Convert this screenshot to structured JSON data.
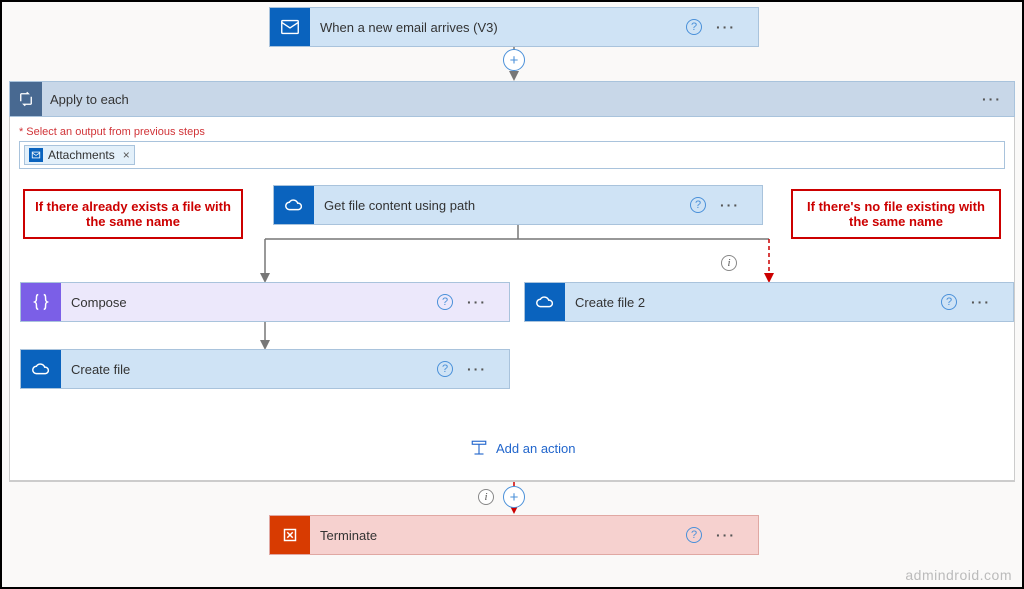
{
  "trigger": {
    "title": "When a new email arrives (V3)"
  },
  "loop": {
    "title": "Apply to each",
    "select_label": "Select an output from previous steps",
    "token_label": "Attachments"
  },
  "actions": {
    "get_file": "Get file content using path",
    "compose": "Compose",
    "create_file_left": "Create file",
    "create_file_right": "Create file 2",
    "terminate": "Terminate"
  },
  "annotations": {
    "left": "If there already exists a file with the same name",
    "right": "If there's no file existing with the same name"
  },
  "add_action": "Add an action",
  "watermark": "admindroid.com"
}
